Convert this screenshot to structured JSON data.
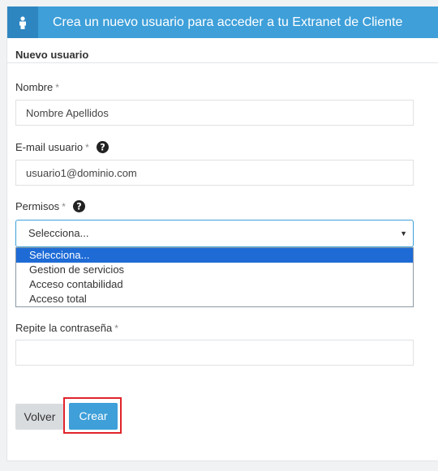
{
  "header": {
    "title": "Crea un nuevo usuario para acceder a tu Extranet de Cliente",
    "icon": "user-icon"
  },
  "section": {
    "title": "Nuevo usuario"
  },
  "fields": {
    "nombre": {
      "label": "Nombre",
      "required_mark": "*",
      "value": "Nombre Apellidos"
    },
    "email": {
      "label": "E-mail usuario",
      "required_mark": "*",
      "value": "usuario1@dominio.com",
      "help_icon": "question-circle-icon"
    },
    "permisos": {
      "label": "Permisos",
      "required_mark": "*",
      "help_icon": "question-circle-icon",
      "selected": "Selecciona...",
      "options": [
        "Selecciona...",
        "Gestion de servicios",
        "Acceso contabilidad",
        "Acceso total"
      ]
    },
    "repite": {
      "label": "Repite la contraseña",
      "required_mark": "*",
      "value": ""
    }
  },
  "buttons": {
    "back": "Volver",
    "create": "Crear"
  },
  "colors": {
    "accent": "#3e9fd9",
    "highlight": "#e0242b",
    "option_selected": "#1e6bd6"
  }
}
